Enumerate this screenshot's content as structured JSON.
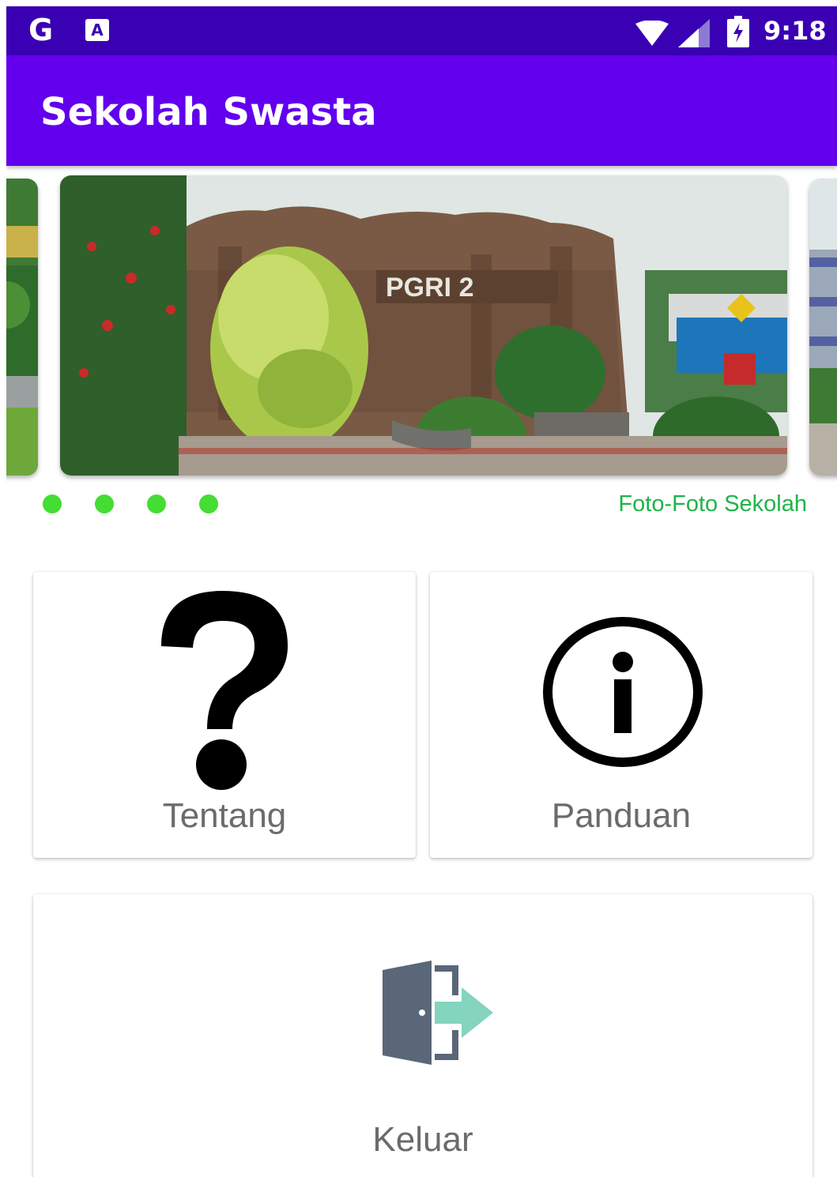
{
  "status_bar": {
    "google_icon_text": "G",
    "translate_icon_text": "A",
    "icons": [
      "google-icon",
      "translate-icon",
      "wifi-icon",
      "signal-icon",
      "battery-charging-icon"
    ],
    "time": "9:18"
  },
  "app_bar": {
    "title": "Sekolah Swasta",
    "color": "#6200ee"
  },
  "carousel": {
    "main_image_sign_text": "PGRI 2",
    "dots_count": 4,
    "dot_color": "#44dd33",
    "caption": "Foto-Foto Sekolah",
    "caption_color": "#1fb34a"
  },
  "menu": {
    "tentang": {
      "label": "Tentang",
      "icon": "question-mark-icon"
    },
    "panduan": {
      "label": "Panduan",
      "icon": "info-icon"
    },
    "keluar": {
      "label": "Keluar",
      "icon": "exit-door-icon"
    }
  }
}
